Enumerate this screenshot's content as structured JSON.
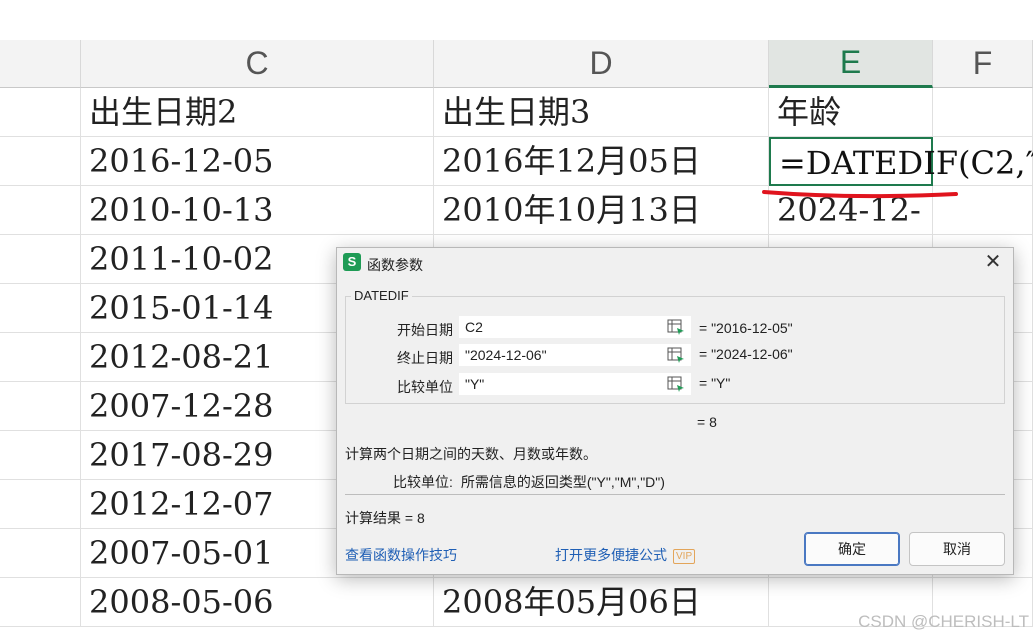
{
  "sheet": {
    "columns": [
      "C",
      "D",
      "E",
      "F"
    ],
    "rows": [
      {
        "c": "出生日期2",
        "d": "出生日期3",
        "e": "年龄"
      },
      {
        "c": "2016-12-05",
        "d": "2016年12月05日",
        "e": "=DATEDIF(C2,″"
      },
      {
        "c": "2010-10-13",
        "d": "2010年10月13日",
        "e": "2024-12-"
      },
      {
        "c": "2011-10-02",
        "d": "",
        "e": ""
      },
      {
        "c": "2015-01-14",
        "d": "",
        "e": ""
      },
      {
        "c": "2012-08-21",
        "d": "",
        "e": ""
      },
      {
        "c": "2007-12-28",
        "d": "",
        "e": ""
      },
      {
        "c": "2017-08-29",
        "d": "",
        "e": ""
      },
      {
        "c": "2012-12-07",
        "d": "",
        "e": ""
      },
      {
        "c": "2007-05-01",
        "d": "",
        "e": ""
      },
      {
        "c": "2008-05-06",
        "d": "2008年05月06日",
        "e": ""
      }
    ],
    "watermark": "CSDN @CHERISH-LT",
    "accent_color": "#1e7a4d",
    "underline_color": "#e0141e"
  },
  "dialog": {
    "app_icon": "S",
    "title": "函数参数",
    "function_name": "DATEDIF",
    "params": [
      {
        "label": "开始日期",
        "value": "C2",
        "result": "= \"2016-12-05\""
      },
      {
        "label": "终止日期",
        "value": "\"2024-12-06\"",
        "result": "= \"2024-12-06\""
      },
      {
        "label": "比较单位",
        "value": "\"Y\"",
        "result": "= \"Y\""
      }
    ],
    "formula_result": "= 8",
    "description": "计算两个日期之间的天数、月数或年数。",
    "arg_label": "比较单位:",
    "arg_description": "所需信息的返回类型(\"Y\",\"M\",\"D\")",
    "calc_result": "计算结果 = 8",
    "link_tips": "查看函数操作技巧",
    "link_more": "打开更多便捷公式",
    "vip_badge": "VIP",
    "ok_label": "确定",
    "cancel_label": "取消",
    "close_icon": "close-icon",
    "ref_icon": "range-select-icon"
  }
}
